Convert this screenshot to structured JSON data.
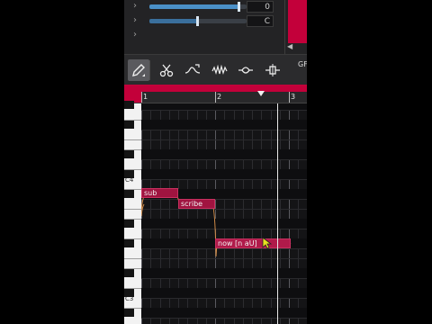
{
  "params": {
    "row1_value": "0",
    "row1_slider_fraction": 0.92,
    "row2_value": "C",
    "row2_slider_fraction": 0.5
  },
  "toolbar": {
    "tools": [
      "pencil-icon",
      "scissors-icon",
      "pitch-curve-icon",
      "vibrato-icon",
      "fade-icon",
      "split-icon"
    ],
    "truncated_label": "GF"
  },
  "ruler": {
    "bars": [
      "1",
      "2",
      "3"
    ]
  },
  "keyboard": {
    "labels": [
      "C4",
      "C3"
    ]
  },
  "notes": [
    {
      "lyric": "sub"
    },
    {
      "lyric": "scribe"
    },
    {
      "lyric": "now [n aU]"
    }
  ]
}
